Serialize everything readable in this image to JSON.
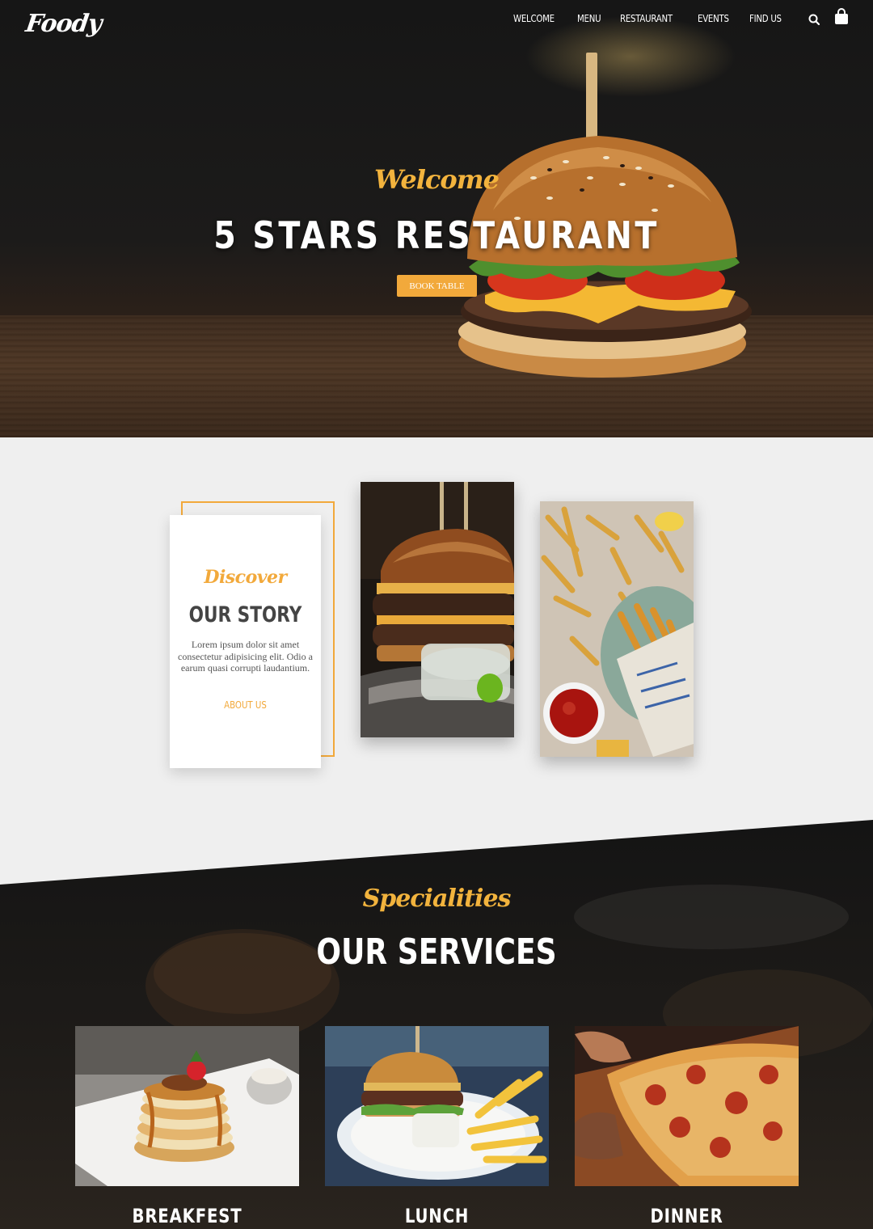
{
  "nav": {
    "logo": "Foody",
    "links": [
      "WELCOME",
      "MENU",
      "RESTAURANT",
      "EVENTS",
      "FIND US"
    ]
  },
  "hero": {
    "script": "Welcome",
    "title": "5 STARS RESTAURANT",
    "button": "BOOK TABLE"
  },
  "story": {
    "script": "Discover",
    "title": "OUR STORY",
    "text": "Lorem ipsum dolor sit amet consectetur adipisicing elit. Odio a earum quasi corrupti laudantium.",
    "link": "ABOUT US"
  },
  "services": {
    "script": "Specialities",
    "title": "OUR SERVICES",
    "items": [
      {
        "label": "BREAKFEST"
      },
      {
        "label": "LUNCH"
      },
      {
        "label": "DINNER"
      }
    ]
  },
  "colors": {
    "accent": "#f2a93b",
    "dark": "#1a1a1a",
    "light_bg": "#efefef"
  }
}
